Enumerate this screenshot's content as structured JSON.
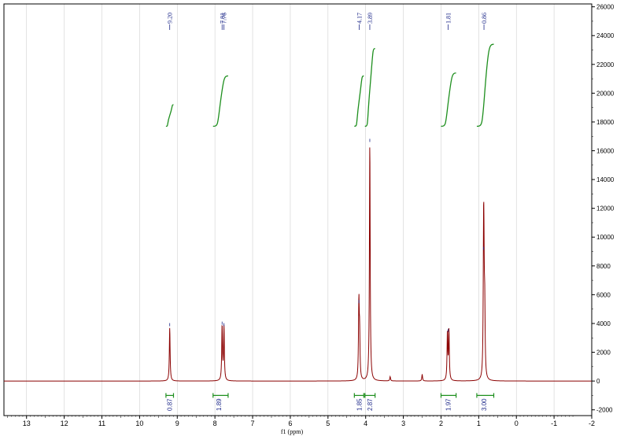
{
  "chart_data": {
    "type": "line",
    "title": "",
    "xlabel": "f1 (ppm)",
    "ylabel": "",
    "xlim": [
      13.6,
      -2.0
    ],
    "ylim": [
      -2400,
      26200
    ],
    "x_ticks": [
      "13",
      "12",
      "11",
      "10",
      "9",
      "8",
      "7",
      "6",
      "5",
      "4",
      "3",
      "2",
      "1",
      "0",
      "-1",
      "-2"
    ],
    "y_ticks": [
      "-2000",
      "0",
      "2000",
      "4000",
      "6000",
      "8000",
      "10000",
      "12000",
      "14000",
      "16000",
      "18000",
      "20000",
      "22000",
      "24000",
      "26000"
    ],
    "peaks": [
      {
        "ppm": 9.2,
        "height": 3700
      },
      {
        "ppm": 7.81,
        "height": 3800
      },
      {
        "ppm": 7.76,
        "height": 3700
      },
      {
        "ppm": 4.18,
        "height": 5300
      },
      {
        "ppm": 4.16,
        "height": 2900
      },
      {
        "ppm": 3.89,
        "height": 16500
      },
      {
        "ppm": 3.35,
        "height": 300
      },
      {
        "ppm": 2.5,
        "height": 450
      },
      {
        "ppm": 1.83,
        "height": 3300
      },
      {
        "ppm": 1.79,
        "height": 3400
      },
      {
        "ppm": 0.87,
        "height": 9000
      },
      {
        "ppm": 0.86,
        "height": 4600
      },
      {
        "ppm": 0.84,
        "height": 4400
      }
    ],
    "peak_labels": [
      "9.20",
      "7.81",
      "7.76",
      "4.17",
      "3.89",
      "1.81",
      "0.86"
    ],
    "peak_label_positions": [
      9.2,
      7.81,
      7.76,
      4.17,
      3.89,
      1.81,
      0.86
    ],
    "integrals": [
      {
        "value": "0.87",
        "from": 9.3,
        "to": 9.1,
        "center": 9.2,
        "y_start": 17700,
        "y_end": 19200
      },
      {
        "value": "1.89",
        "from": 8.05,
        "to": 7.65,
        "center": 7.9,
        "y_start": 17700,
        "y_end": 21200
      },
      {
        "value": "1.85",
        "from": 4.3,
        "to": 4.05,
        "center": 4.17,
        "y_start": 17700,
        "y_end": 21200
      },
      {
        "value": "2.87",
        "from": 4.02,
        "to": 3.75,
        "center": 3.89,
        "y_start": 17700,
        "y_end": 23100
      },
      {
        "value": "1.97",
        "from": 2.0,
        "to": 1.6,
        "center": 1.81,
        "y_start": 17700,
        "y_end": 21400
      },
      {
        "value": "3.00",
        "from": 1.05,
        "to": 0.6,
        "center": 0.86,
        "y_start": 17700,
        "y_end": 23400
      }
    ],
    "colors": {
      "spectrum": "#8b0000",
      "integral": "#1e8f1e",
      "label": "#1f2a8a",
      "grid": "#d0d0d0",
      "axis": "#000000"
    }
  }
}
